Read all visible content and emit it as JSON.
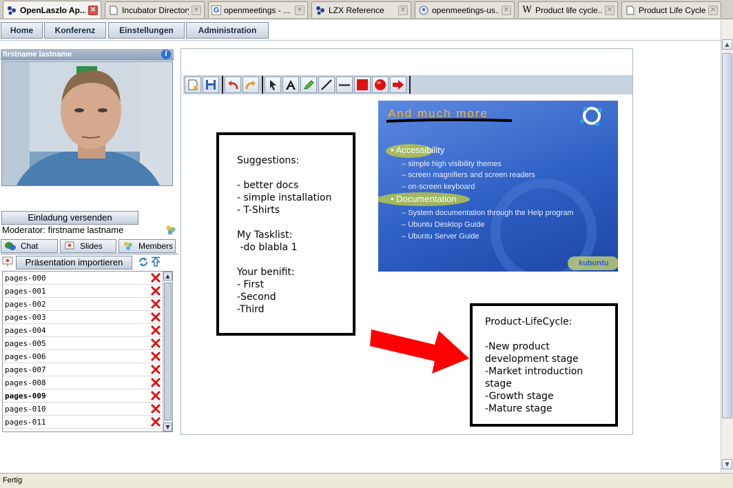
{
  "browser": {
    "tabs": [
      {
        "label": "OpenLaszlo Ap...",
        "icon": "openlaszlo-icon",
        "active": true
      },
      {
        "label": "Incubator Directory",
        "icon": "page-icon",
        "active": false
      },
      {
        "label": "openmeetings - ...",
        "icon": "google-icon",
        "active": false
      },
      {
        "label": "LZX Reference",
        "icon": "openlaszlo-icon",
        "active": false
      },
      {
        "label": "openmeetings-us...",
        "icon": "mail-group-icon",
        "active": false
      },
      {
        "label": "Product life cycle...",
        "icon": "wikipedia-icon",
        "active": false
      },
      {
        "label": "Product Life Cycle",
        "icon": "page-icon",
        "active": false
      }
    ],
    "status_text": "Fertig"
  },
  "menu": {
    "items": [
      "Home",
      "Konferenz",
      "Einstellungen",
      "Administration"
    ]
  },
  "sidebar": {
    "user_name": "firstname lastname",
    "invite_label": "Einladung versenden",
    "moderator_text": "Moderator: firstname lastname",
    "tabs": [
      {
        "label": "Chat",
        "icon": "chat-icon"
      },
      {
        "label": "Slides",
        "icon": "slides-icon"
      },
      {
        "label": "Members",
        "icon": "members-icon"
      }
    ],
    "import_label": "Präsentation importieren",
    "pages": [
      {
        "name": "pages-000",
        "bold": false
      },
      {
        "name": "pages-001",
        "bold": false
      },
      {
        "name": "pages-002",
        "bold": false
      },
      {
        "name": "pages-003",
        "bold": false
      },
      {
        "name": "pages-004",
        "bold": false
      },
      {
        "name": "pages-005",
        "bold": false
      },
      {
        "name": "pages-006",
        "bold": false
      },
      {
        "name": "pages-007",
        "bold": false
      },
      {
        "name": "pages-008",
        "bold": false
      },
      {
        "name": "pages-009",
        "bold": true
      },
      {
        "name": "pages-010",
        "bold": false
      },
      {
        "name": "pages-011",
        "bold": false
      }
    ]
  },
  "whiteboard": {
    "tools": [
      "new-document-icon",
      "save-icon",
      "undo-icon",
      "redo-icon",
      "pointer-icon",
      "text-icon",
      "highlighter-icon",
      "line-icon",
      "underline-icon",
      "rectangle-icon",
      "ellipse-icon",
      "arrow-icon"
    ],
    "slide": {
      "title": "And much more",
      "bullets": [
        {
          "text": "Accessibility",
          "subs": [
            "simple high visibility themes",
            "screen magnifiers and screen readers",
            "on-screen keyboard"
          ]
        },
        {
          "text": "Documentation",
          "subs": [
            "System documentation through the Help program",
            "Ubuntu Desktop Guide",
            "Ubuntu Server Guide"
          ]
        }
      ],
      "footer": "kubuntu"
    },
    "note_left": [
      "Suggestions:",
      "",
      "- better docs",
      "- simple installation",
      "- T-Shirts",
      "",
      "My Tasklist:",
      " -do blabla 1",
      "",
      "Your benifit:",
      "- First",
      "-Second",
      "-Third"
    ],
    "note_right": [
      "Product-LifeCycle:",
      "",
      "-New product",
      "development stage",
      "-Market introduction",
      "stage",
      "-Growth stage",
      "-Mature stage"
    ],
    "arrow_color": "#ff0000"
  }
}
